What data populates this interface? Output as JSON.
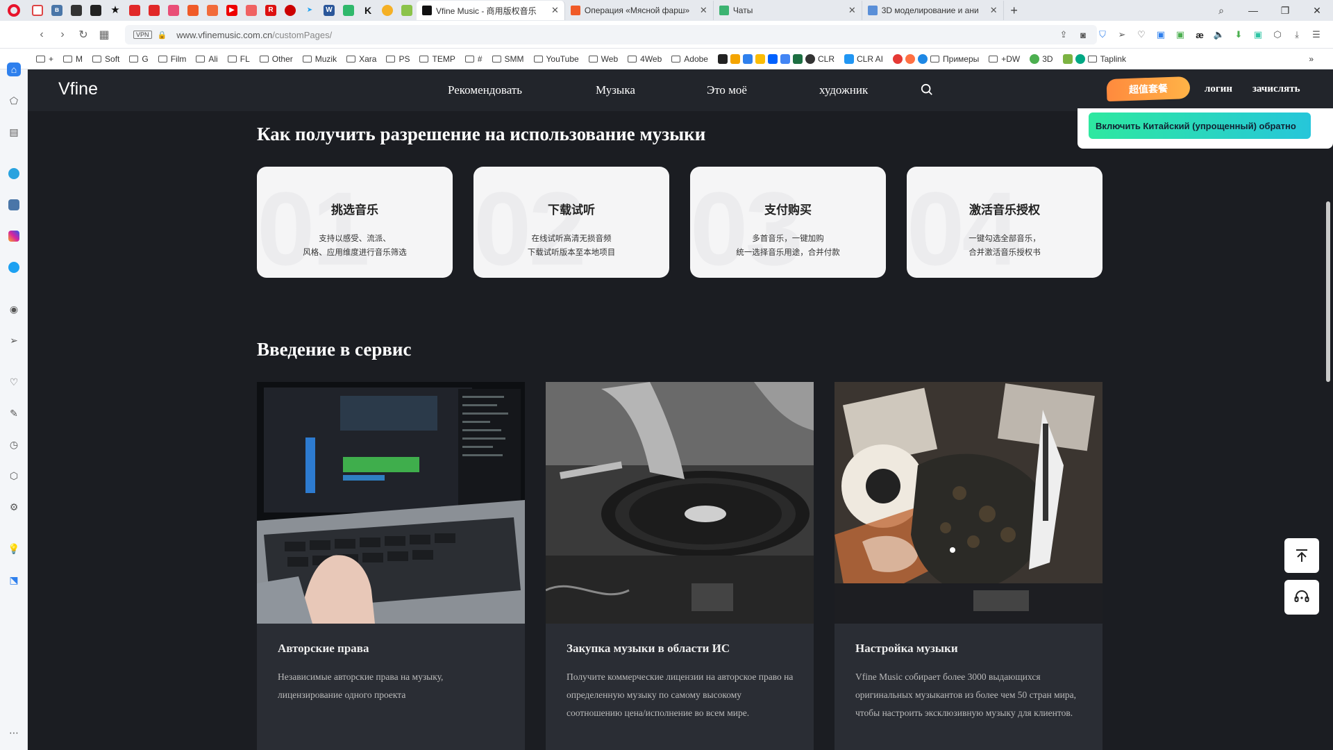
{
  "browser": {
    "pinned_icons": [
      "gmail-icon",
      "vk-icon",
      "tool-icon",
      "notes-icon",
      "star-icon",
      "flipboard-icon",
      "flipboard-icon",
      "app-icon",
      "app-icon",
      "app-icon",
      "youtube-icon",
      "search-icon",
      "app-icon",
      "app-icon",
      "tweetdeck-icon",
      "word-icon",
      "app-icon",
      "k-icon",
      "app-icon",
      "app-icon"
    ],
    "tabs": [
      {
        "title": "Vfine Music - 商用版权音乐",
        "active": true,
        "color": "#111"
      },
      {
        "title": "Операция «Мясной фарш»",
        "active": false,
        "color": "#f05a28"
      },
      {
        "title": "Чаты",
        "active": false,
        "color": "#3cb371"
      },
      {
        "title": "3D моделирование и ани",
        "active": false,
        "color": "#5a8fd8"
      }
    ],
    "vpn_label": "VPN",
    "url_host": "www.vfinemusic.com.cn",
    "url_path": "/customPages/",
    "bookmarks": [
      "+",
      "M",
      "Soft",
      "G",
      "Film",
      "Ali",
      "FL",
      "Other",
      "Muzik",
      "Xara",
      "PS",
      "TEMP",
      "#",
      "SMM",
      "YouTube",
      "Web",
      "4Web",
      "Adobe",
      "CLR",
      "CLR AI",
      "Примеры",
      "+DW",
      "3D",
      "Taplink"
    ]
  },
  "site": {
    "logo": "Vfine",
    "nav": [
      "Рекомендовать",
      "Музыка",
      "Это моё",
      "художник"
    ],
    "promo": "超值套餐",
    "login": "логин",
    "register": "зачислять",
    "translate_button": "Включить Китайский (упрощенный) обратно"
  },
  "section1": {
    "title": "Как получить разрешение на использование музыки",
    "steps": [
      {
        "num": "01",
        "title": "挑选音乐",
        "line1": "支持以感受、流派、",
        "line2": "风格、应用维度进行音乐筛选"
      },
      {
        "num": "02",
        "title": "下载试听",
        "line1": "在线试听高清无损音频",
        "line2": "下载试听版本至本地项目"
      },
      {
        "num": "03",
        "title": "支付购买",
        "line1": "多首音乐，一键加购",
        "line2": "统一选择音乐用途，合并付款"
      },
      {
        "num": "04",
        "title": "激活音乐授权",
        "line1": "一键勾选全部音乐，",
        "line2": "合并激活音乐授权书"
      }
    ]
  },
  "section2": {
    "title": "Введение в сервис",
    "cards": [
      {
        "title": "Авторские права",
        "desc": "Независимые авторские права на музыку, лицензирование одного проекта"
      },
      {
        "title": "Закупка музыки в области ИС",
        "desc": "Получите коммерческие лицензии на авторское право на определенную музыку по самому высокому соотношению цена/исполнение во всем мире."
      },
      {
        "title": "Настройка музыки",
        "desc": "Vfine Music собирает более 3000 выдающихся оригинальных музыкантов из более чем 50 стран мира, чтобы настроить эксклюзивную музыку для клиентов."
      }
    ]
  }
}
